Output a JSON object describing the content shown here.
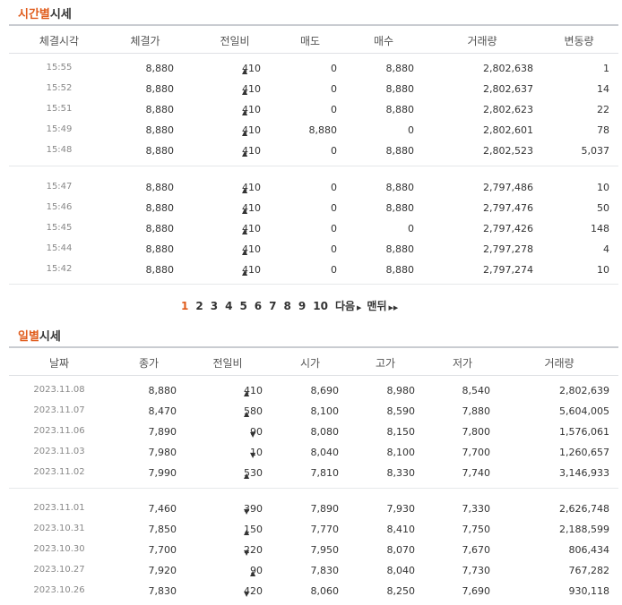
{
  "hourly": {
    "title_highlight": "시간별",
    "title_rest": "시세",
    "headers": [
      "체결시각",
      "체결가",
      "전일비",
      "매도",
      "매수",
      "거래량",
      "변동량"
    ],
    "rows": [
      {
        "time": "15:55",
        "price": "8,880",
        "dir": "up",
        "change": "410",
        "sell": "0",
        "buy": "8,880",
        "volume": "2,802,638",
        "delta": "1"
      },
      {
        "time": "15:52",
        "price": "8,880",
        "dir": "up",
        "change": "410",
        "sell": "0",
        "buy": "8,880",
        "volume": "2,802,637",
        "delta": "14"
      },
      {
        "time": "15:51",
        "price": "8,880",
        "dir": "up",
        "change": "410",
        "sell": "0",
        "buy": "8,880",
        "volume": "2,802,623",
        "delta": "22"
      },
      {
        "time": "15:49",
        "price": "8,880",
        "dir": "up",
        "change": "410",
        "sell": "8,880",
        "buy": "0",
        "volume": "2,802,601",
        "delta": "78"
      },
      {
        "time": "15:48",
        "price": "8,880",
        "dir": "up",
        "change": "410",
        "sell": "0",
        "buy": "8,880",
        "volume": "2,802,523",
        "delta": "5,037"
      },
      {
        "time": "15:47",
        "price": "8,880",
        "dir": "up",
        "change": "410",
        "sell": "0",
        "buy": "8,880",
        "volume": "2,797,486",
        "delta": "10"
      },
      {
        "time": "15:46",
        "price": "8,880",
        "dir": "up",
        "change": "410",
        "sell": "0",
        "buy": "8,880",
        "volume": "2,797,476",
        "delta": "50"
      },
      {
        "time": "15:45",
        "price": "8,880",
        "dir": "up",
        "change": "410",
        "sell": "0",
        "buy": "0",
        "volume": "2,797,426",
        "delta": "148"
      },
      {
        "time": "15:44",
        "price": "8,880",
        "dir": "up",
        "change": "410",
        "sell": "0",
        "buy": "8,880",
        "volume": "2,797,278",
        "delta": "4"
      },
      {
        "time": "15:42",
        "price": "8,880",
        "dir": "up",
        "change": "410",
        "sell": "0",
        "buy": "8,880",
        "volume": "2,797,274",
        "delta": "10"
      }
    ]
  },
  "pagination": {
    "pages": [
      "1",
      "2",
      "3",
      "4",
      "5",
      "6",
      "7",
      "8",
      "9",
      "10"
    ],
    "current": "1",
    "next_label": "다음",
    "last_label": "맨뒤",
    "arrow_icon": "right-triangle-icon",
    "double_arrow_icon": "double-right-triangle-icon"
  },
  "daily": {
    "title_highlight": "일별",
    "title_rest": "시세",
    "headers": [
      "날짜",
      "종가",
      "전일비",
      "시가",
      "고가",
      "저가",
      "거래량"
    ],
    "rows": [
      {
        "date": "2023.11.08",
        "close": "8,880",
        "dir": "up",
        "change": "410",
        "open": "8,690",
        "high": "8,980",
        "low": "8,540",
        "volume": "2,802,639"
      },
      {
        "date": "2023.11.07",
        "close": "8,470",
        "dir": "up",
        "change": "580",
        "open": "8,100",
        "high": "8,590",
        "low": "7,880",
        "volume": "5,604,005"
      },
      {
        "date": "2023.11.06",
        "close": "7,890",
        "dir": "down",
        "change": "90",
        "open": "8,080",
        "high": "8,150",
        "low": "7,800",
        "volume": "1,576,061"
      },
      {
        "date": "2023.11.03",
        "close": "7,980",
        "dir": "down",
        "change": "10",
        "open": "8,040",
        "high": "8,100",
        "low": "7,700",
        "volume": "1,260,657"
      },
      {
        "date": "2023.11.02",
        "close": "7,990",
        "dir": "up",
        "change": "530",
        "open": "7,810",
        "high": "8,330",
        "low": "7,740",
        "volume": "3,146,933"
      },
      {
        "date": "2023.11.01",
        "close": "7,460",
        "dir": "down",
        "change": "390",
        "open": "7,890",
        "high": "7,930",
        "low": "7,330",
        "volume": "2,626,748"
      },
      {
        "date": "2023.10.31",
        "close": "7,850",
        "dir": "up",
        "change": "150",
        "open": "7,770",
        "high": "8,410",
        "low": "7,750",
        "volume": "2,188,599"
      },
      {
        "date": "2023.10.30",
        "close": "7,700",
        "dir": "down",
        "change": "220",
        "open": "7,950",
        "high": "8,070",
        "low": "7,670",
        "volume": "806,434"
      },
      {
        "date": "2023.10.27",
        "close": "7,920",
        "dir": "up",
        "change": "90",
        "open": "7,830",
        "high": "8,040",
        "low": "7,730",
        "volume": "767,282"
      },
      {
        "date": "2023.10.26",
        "close": "7,830",
        "dir": "down",
        "change": "420",
        "open": "8,060",
        "high": "8,250",
        "low": "7,690",
        "volume": "930,118"
      }
    ]
  },
  "colors": {
    "accent": "#e05c1c",
    "up": "#d61a1a",
    "down": "#1a5fd6"
  }
}
